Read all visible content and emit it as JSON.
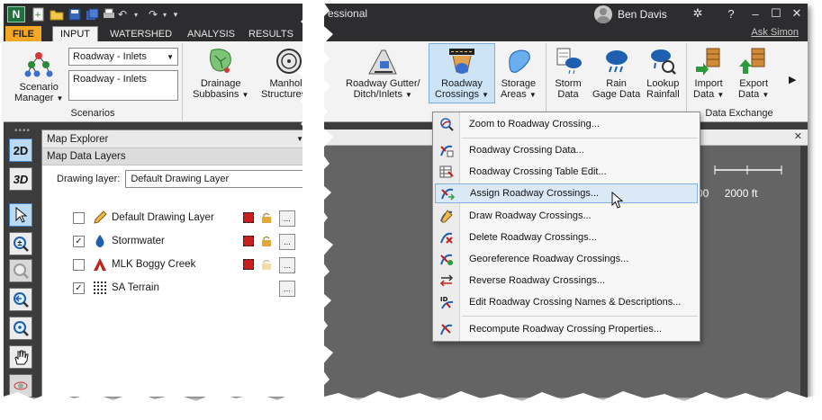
{
  "window": {
    "title_fragment": "essional",
    "user_name": "Ben Davis",
    "ask_link": "Ask Simon"
  },
  "tabs": [
    {
      "label": "FILE"
    },
    {
      "label": "INPUT"
    },
    {
      "label": "WATERSHED"
    },
    {
      "label": "ANALYSIS"
    },
    {
      "label": "RESULTS"
    }
  ],
  "ribbon": {
    "scenarios": {
      "group_label": "Scenarios",
      "manager_label_1": "Scenario",
      "manager_label_2": "Manager",
      "combo_value": "Roadway - Inlets",
      "list_value": "Roadway - Inlets"
    },
    "buttons": {
      "drainage_1": "Drainage",
      "drainage_2": "Subbasins",
      "manhole_1": "Manhole",
      "manhole_2": "Structures",
      "gutter_1": "Roadway Gutter/",
      "gutter_2": "Ditch/Inlets",
      "crossings_1": "Roadway",
      "crossings_2": "Crossings",
      "storage_1": "Storage",
      "storage_2": "Areas",
      "storm_1": "Storm",
      "storm_2": "Data",
      "gage_1": "Rain",
      "gage_2": "Gage Data",
      "lookup_1": "Lookup",
      "lookup_2": "Rainfall",
      "import_1": "Import",
      "import_2": "Data",
      "export_1": "Export",
      "export_2": "Data"
    },
    "data_exchange_label": "Data Exchange"
  },
  "left_toolbar": {
    "btn_2d": "2D",
    "btn_3d": "3D"
  },
  "explorer": {
    "title": "Map Explorer",
    "subtitle": "Map Data Layers",
    "drawing_layer_label": "Drawing layer:",
    "drawing_layer_value": "Default Drawing Layer",
    "layers": [
      {
        "name": "Default Drawing Layer",
        "checked": false
      },
      {
        "name": "Stormwater",
        "checked": true
      },
      {
        "name": "MLK Boggy Creek",
        "checked": false
      },
      {
        "name": "SA Terrain",
        "checked": true
      }
    ],
    "more_button": "..."
  },
  "map": {
    "scale_mid": "00",
    "scale_end": "2000 ft"
  },
  "menu": {
    "items": [
      {
        "label": "Zoom to Roadway Crossing...",
        "icon": "zoom-crossing-icon"
      },
      {
        "label": "Roadway Crossing Data...",
        "icon": "crossing-data-icon"
      },
      {
        "label": "Roadway Crossing Table Edit...",
        "icon": "table-edit-icon"
      },
      {
        "label": "Assign Roadway Crossings...",
        "icon": "assign-crossing-icon"
      },
      {
        "label": "Draw Roadway Crossings...",
        "icon": "draw-crossing-icon"
      },
      {
        "label": "Delete Roadway Crossings...",
        "icon": "delete-crossing-icon"
      },
      {
        "label": "Georeference Roadway Crossings...",
        "icon": "georeference-icon"
      },
      {
        "label": "Reverse Roadway Crossings...",
        "icon": "reverse-crossing-icon"
      },
      {
        "label": "Edit Roadway Crossing Names & Descriptions...",
        "icon": "edit-names-icon"
      },
      {
        "label": "Recompute Roadway Crossing Properties...",
        "icon": "recompute-icon"
      }
    ]
  },
  "colors": {
    "accent_file": "#f5a623",
    "highlight": "#cde4f7",
    "map_bg": "#646464"
  }
}
